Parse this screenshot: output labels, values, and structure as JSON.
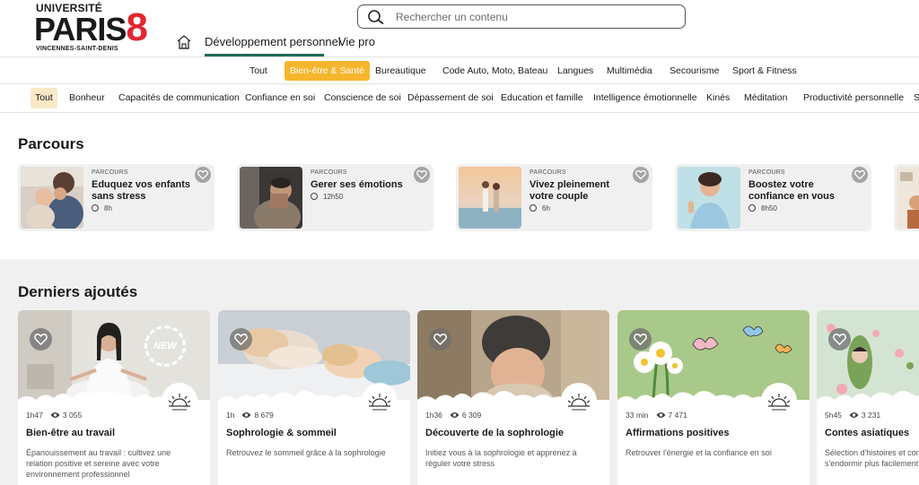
{
  "header": {
    "logo": {
      "line1": "UNIVERSITÉ",
      "line2": "PARIS",
      "line2_accent": "8",
      "line3": "VINCENNES-SAINT-DENIS"
    },
    "nav": [
      {
        "label": "Développement personnel",
        "active": true
      },
      {
        "label": "Vie pro",
        "active": false
      }
    ],
    "search": {
      "placeholder": "Rechercher un contenu"
    },
    "accent_color": "#1d6b57"
  },
  "categories": [
    {
      "label": "Tout",
      "active": false
    },
    {
      "label": "Bien-être & Santé",
      "active": true
    },
    {
      "label": "Bureautique",
      "active": false
    },
    {
      "label": "Code Auto, Moto, Bateau",
      "active": false
    },
    {
      "label": "Langues",
      "active": false
    },
    {
      "label": "Multimédia",
      "active": false
    },
    {
      "label": "Secourisme",
      "active": false
    },
    {
      "label": "Sport & Fitness",
      "active": false
    }
  ],
  "subcategories": [
    {
      "label": "Tout",
      "active": true
    },
    {
      "label": "Bonheur",
      "active": false
    },
    {
      "label": "Capacités de communication",
      "active": false
    },
    {
      "label": "Confiance en soi",
      "active": false
    },
    {
      "label": "Conscience de soi",
      "active": false
    },
    {
      "label": "Dépassement de soi",
      "active": false
    },
    {
      "label": "Education et famille",
      "active": false
    },
    {
      "label": "Intelligence émotionnelle",
      "active": false
    },
    {
      "label": "Kinés",
      "active": false
    },
    {
      "label": "Méditation",
      "active": false
    },
    {
      "label": "Productivité personnelle",
      "active": false
    },
    {
      "label": "S",
      "active": false
    }
  ],
  "parcours": {
    "title": "Parcours",
    "items": [
      {
        "kicker": "PARCOURS",
        "title": "Eduquez vos enfants sans stress",
        "duration": "8h"
      },
      {
        "kicker": "PARCOURS",
        "title": "Gerer ses émotions",
        "duration": "12h50"
      },
      {
        "kicker": "PARCOURS",
        "title": "Vivez pleinement votre couple",
        "duration": "6h"
      },
      {
        "kicker": "PARCOURS",
        "title": "Boostez votre confiance en vous",
        "duration": "8h50"
      }
    ]
  },
  "derniers": {
    "title": "Derniers ajoutés",
    "items": [
      {
        "duration": "1h47",
        "views": "3 055",
        "title": "Bien-être au travail",
        "desc": "Épanouissement au travail : cultivez une relation positive et sereine avec votre environnement professionnel",
        "badge": "NEW"
      },
      {
        "duration": "1h",
        "views": "8 679",
        "title": "Sophrologie & sommeil",
        "desc": "Retrouvez le sommeil grâce à la sophrologie"
      },
      {
        "duration": "1h36",
        "views": "6 309",
        "title": "Découverte de la sophrologie",
        "desc": "Initiez vous à la sophrologie et apprenez à réguler votre stress"
      },
      {
        "duration": "33 min",
        "views": "7 471",
        "title": "Affirmations positives",
        "desc": "Retrouver l'énergie et la confiance en soi"
      },
      {
        "duration": "5h45",
        "views": "3 231",
        "title": "Contes asiatiques",
        "desc": "Sélection d'histoires et contes asiatiques et s'endormir plus facilement"
      }
    ]
  }
}
